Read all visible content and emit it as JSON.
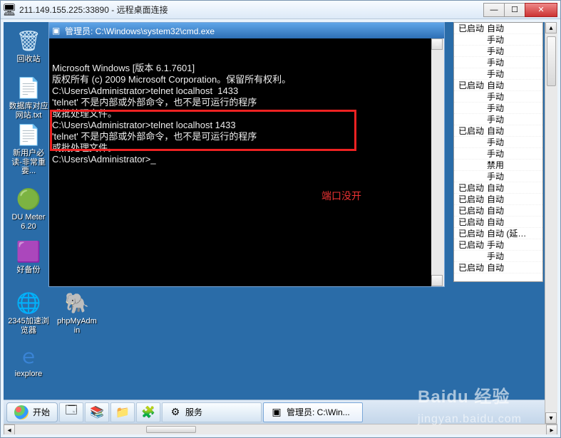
{
  "rdp": {
    "title": "211.149.155.225:33890 - 远程桌面连接"
  },
  "desktop_icons": [
    {
      "id": "recycle",
      "label": "回收站",
      "glyph": "🗑",
      "color": "#cfe7f7"
    },
    {
      "id": "txt",
      "label": "数据库对应网站.txt",
      "glyph": "📄",
      "color": "#fff"
    },
    {
      "id": "txt2",
      "label": "新用户必读-非常重要...",
      "glyph": "📄",
      "color": "#fff"
    },
    {
      "id": "dumeter",
      "label": "DU Meter 6.20",
      "glyph": "🟢",
      "color": "#2aa"
    },
    {
      "id": "backup",
      "label": "好备份",
      "glyph": "🟪",
      "color": "#b5d"
    },
    {
      "id": "2345",
      "label": "2345加速浏览器",
      "glyph": "🌐",
      "color": "#4ad"
    },
    {
      "id": "iexplore",
      "label": "iexplore",
      "glyph": "ｅ",
      "color": "#3a84d6"
    },
    {
      "id": "phpmyadmin",
      "label": "phpMyAdmin",
      "glyph": "🐘",
      "color": "#f90"
    }
  ],
  "cmd": {
    "title": "管理员: C:\\Windows\\system32\\cmd.exe",
    "lines": [
      "Microsoft Windows [版本 6.1.7601]",
      "版权所有 (c) 2009 Microsoft Corporation。保留所有权利。",
      "",
      "C:\\Users\\Administrator>telnet localhost  1433",
      "'telnet' 不是内部或外部命令，也不是可运行的程序",
      "或批处理文件。",
      "",
      "C:\\Users\\Administrator>telnet localhost 1433",
      "'telnet' 不是内部或外部命令，也不是可运行的程序",
      "或批处理文件。",
      "",
      "C:\\Users\\Administrator>"
    ],
    "annotation": "端口没开"
  },
  "services_rows": [
    [
      "已启动",
      "自动"
    ],
    [
      "",
      "手动"
    ],
    [
      "",
      "手动"
    ],
    [
      "",
      "手动"
    ],
    [
      "",
      "手动"
    ],
    [
      "已启动",
      "自动"
    ],
    [
      "",
      "手动"
    ],
    [
      "",
      "手动"
    ],
    [
      "",
      "手动"
    ],
    [
      "已启动",
      "自动"
    ],
    [
      "",
      "手动"
    ],
    [
      "",
      "手动"
    ],
    [
      "",
      "禁用"
    ],
    [
      "",
      "手动"
    ],
    [
      "已启动",
      "自动"
    ],
    [
      "已启动",
      "自动"
    ],
    [
      "已启动",
      "自动"
    ],
    [
      "已启动",
      "自动"
    ],
    [
      "已启动",
      "自动 (延…"
    ],
    [
      "已启动",
      "手动"
    ],
    [
      "",
      "手动"
    ],
    [
      "已启动",
      "自动"
    ]
  ],
  "taskbar": {
    "start": "开始",
    "services_label": "服务",
    "cmd_label": "管理员: C:\\Win..."
  },
  "watermark": {
    "main": "Baidu 经验",
    "sub": "jingyan.baidu.com"
  }
}
